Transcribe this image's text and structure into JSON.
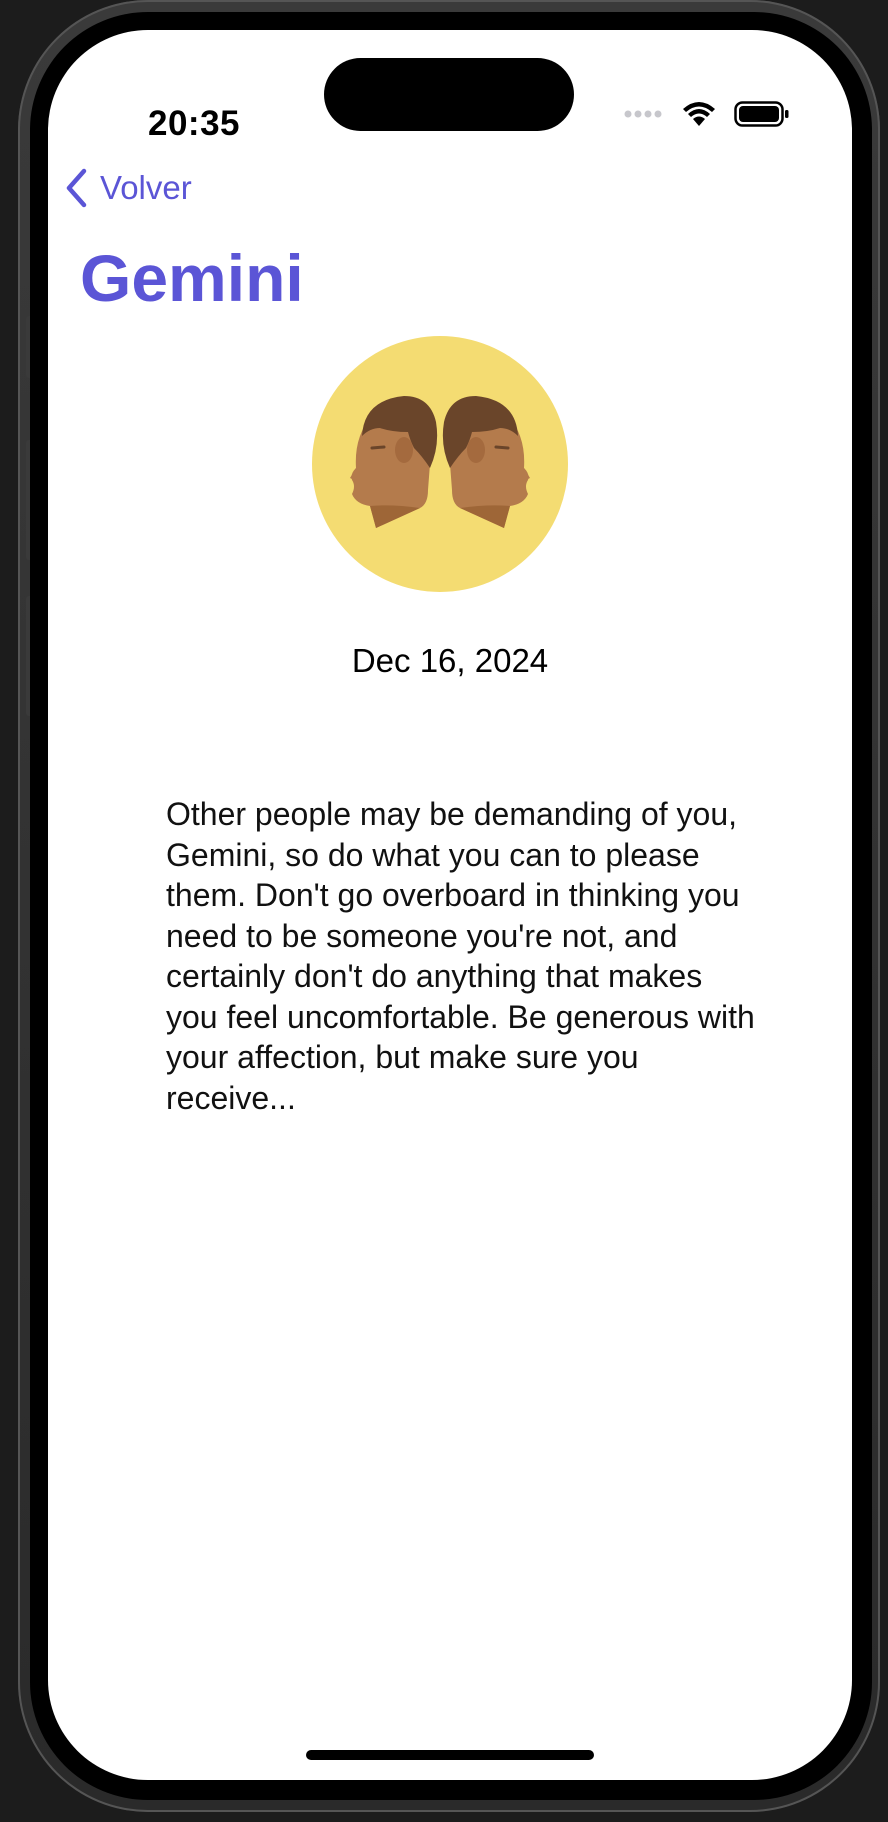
{
  "status_bar": {
    "time": "20:35",
    "signal_icon": "signal-dots-icon",
    "wifi_icon": "wifi-icon",
    "battery_icon": "battery-full-icon"
  },
  "nav": {
    "back_label": "Volver",
    "back_icon": "chevron-left-icon"
  },
  "sign": {
    "name": "Gemini",
    "icon": "gemini-twins-icon",
    "circle_color": "#f4dc72",
    "accent": "#5b55d6"
  },
  "reading": {
    "date": "Dec 16, 2024",
    "text": "Other people may be demanding of you, Gemini, so do what you can to please them. Don't go overboard in thinking you need to be someone you're not, and certainly don't do anything that makes you feel uncomfortable. Be generous with your affection, but make sure you receive..."
  }
}
